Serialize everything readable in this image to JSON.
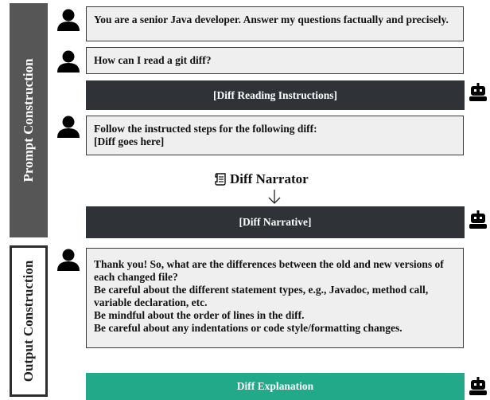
{
  "bands": {
    "prompt": "Prompt Construction",
    "output": "Output Construction"
  },
  "boxes": {
    "system": "You are a senior Java developer. Answer my questions factually and precisely.",
    "question": "How can I read a git diff?",
    "instructions": "[Diff Reading Instructions]",
    "follow_1": "Follow the instructed steps for the following diff:",
    "follow_2": "[Diff goes here]",
    "narrative": "[Diff Narrative]",
    "thank_lines": [
      "Thank you! So, what are the differences between the old and new versions of each changed file?",
      "Be careful about the different statement types, e.g., Javadoc, method call, variable declaration, etc.",
      "Be mindful about the order of lines in the diff.",
      "Be careful about any indentations or code style/formatting changes."
    ],
    "explanation": "Diff Explanation"
  },
  "narrator": {
    "label": "Diff Narrator",
    "icon": "scroll-icon"
  },
  "colors": {
    "prompt_band": "#565656",
    "dark_box": "#2f3337",
    "explanation_box": "#21a98a",
    "user_box": "#efefef"
  }
}
